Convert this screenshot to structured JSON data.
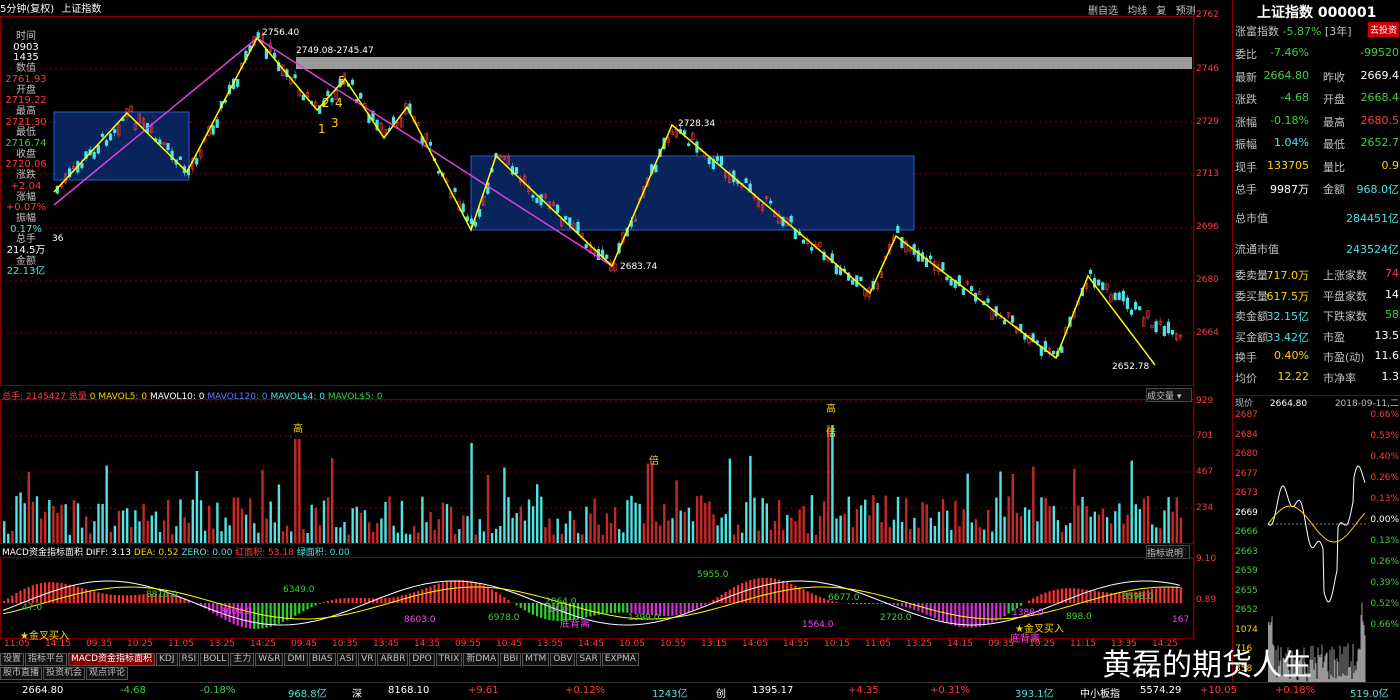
{
  "topbar": {
    "period": "5分钟(复权)",
    "name": "上证指数",
    "buttons": [
      "删自选",
      "均线",
      "复",
      "预测"
    ]
  },
  "left_info": {
    "items": [
      {
        "label": "时间",
        "value": "0903",
        "color": "white"
      },
      {
        "label": "",
        "value": "1435",
        "color": "white"
      },
      {
        "label": "数值",
        "value": "2761.93",
        "color": "red"
      },
      {
        "label": "开盘",
        "value": "2719.22",
        "color": "red"
      },
      {
        "label": "最高",
        "value": "2721.30",
        "color": "red"
      },
      {
        "label": "最低",
        "value": "2716.74",
        "color": "green"
      },
      {
        "label": "收盘",
        "value": "2720.06",
        "color": "red"
      },
      {
        "label": "涨跌",
        "value": "+2.04",
        "color": "red"
      },
      {
        "label": "涨幅",
        "value": "+0.07%",
        "color": "red"
      },
      {
        "label": "振幅",
        "value": "0.17%",
        "color": "cyan"
      },
      {
        "label": "总手",
        "value": "214.5万",
        "color": "white"
      },
      {
        "label": "金额",
        "value": "22.13亿",
        "color": "cyan"
      }
    ]
  },
  "price_axis": [
    "2762",
    "2746",
    "2729",
    "2713",
    "2696",
    "2680",
    "2664"
  ],
  "price_annotations": {
    "high1": "2756.40",
    "range": "2749.08-2745.47",
    "mid_high": "2728.34",
    "low1": "2683.74",
    "low2": "2652.78",
    "left36": "36",
    "nums": [
      "1",
      "2",
      "3",
      "4",
      "5"
    ]
  },
  "volume": {
    "header": [
      {
        "text": "总手: 2145427",
        "color": "red"
      },
      {
        "text": "总量",
        "color": "red"
      },
      {
        "text": "0 MAVOL5: 0",
        "color": "yellow"
      },
      {
        "text": "MAVOL10: 0",
        "color": "white"
      },
      {
        "text": "MAVOL120: 0",
        "color": "blue"
      },
      {
        "text": "MAVOL$4: 0",
        "color": "cyan"
      },
      {
        "text": "MAVOL$5: 0",
        "color": "green"
      }
    ],
    "axis": [
      "929",
      "701",
      "467",
      "234"
    ],
    "button": "成交量",
    "marks": {
      "high": "高",
      "bei": "倍"
    }
  },
  "macd": {
    "header": [
      {
        "text": "MACD资金指标面积",
        "color": "white"
      },
      {
        "text": "DIFF: 3.13",
        "color": "white"
      },
      {
        "text": "DEA: 0.52",
        "color": "yellow"
      },
      {
        "text": "ZERO: 0.00",
        "color": "cyan"
      },
      {
        "text": "红面积: 53.18",
        "color": "red"
      },
      {
        "text": "绿面积: 0.00",
        "color": "cyan"
      }
    ],
    "axis": [
      "9.10",
      "0.89"
    ],
    "button": "指标说明",
    "labels": [
      "47.0",
      "3604.0",
      "8819.0",
      "6349.0",
      "8603.0",
      "6978.0",
      "2064.0",
      "14.0",
      "1399.0",
      "5955.0",
      "1564.0",
      "6677.0",
      "2720.0",
      "1388.0",
      "898.0",
      "3598.0",
      "167"
    ],
    "signals": [
      "金叉买入",
      "底背离",
      "金叉买入",
      "底背离"
    ]
  },
  "time_axis": [
    "11:05",
    "14:15",
    "09:35",
    "10:25",
    "11:05",
    "13:25",
    "14:25",
    "09:45",
    "10:35",
    "13:45",
    "14:35",
    "09:55",
    "10:45",
    "13:55",
    "14:45",
    "10:05",
    "10:55",
    "13:15",
    "14:05",
    "14:55",
    "10:15",
    "11:05",
    "13:25",
    "14:15",
    "09:35",
    "10:25",
    "11:15",
    "13:35",
    "14:25"
  ],
  "tabs": [
    "设置",
    "指标平台",
    "MACD资金指标面积",
    "KDJ",
    "RSI",
    "BOLL",
    "主力",
    "W&R",
    "DMI",
    "BIAS",
    "ASI",
    "VR",
    "ARBR",
    "DPO",
    "TRIX",
    "新DMA",
    "BBI",
    "MTM",
    "OBV",
    "SAR",
    "EXPMA"
  ],
  "tabs2": [
    "股市直播",
    "投资机会",
    "观点评论"
  ],
  "bottom": [
    {
      "text": "2664.80",
      "color": "white"
    },
    {
      "text": "-4.68",
      "color": "green"
    },
    {
      "text": "-0.18%",
      "color": "green"
    },
    {
      "text": "968.8亿",
      "color": "cyan"
    },
    {
      "text": "深",
      "color": "white"
    },
    {
      "text": "8168.10",
      "color": "white"
    },
    {
      "text": "+9.61",
      "color": "red"
    },
    {
      "text": "+0.12%",
      "color": "red"
    },
    {
      "text": "1243亿",
      "color": "cyan"
    },
    {
      "text": "创",
      "color": "white"
    },
    {
      "text": "1395.17",
      "color": "white"
    },
    {
      "text": "+4.35",
      "color": "red"
    },
    {
      "text": "+0.31%",
      "color": "red"
    },
    {
      "text": "393.1亿",
      "color": "cyan"
    },
    {
      "text": "中小板指",
      "color": "white"
    },
    {
      "text": "5574.29",
      "color": "white"
    },
    {
      "text": "+10.05",
      "color": "red"
    },
    {
      "text": "+0.18%",
      "color": "red"
    },
    {
      "text": "519.0亿",
      "color": "cyan"
    }
  ],
  "right_panel": {
    "title": "上证指数 000001",
    "sub_name": "涨富指数",
    "sub_change": "-5.87%",
    "sub_period": "[3年]",
    "sub_btn": "去投资",
    "rows": [
      {
        "k": "委比",
        "v": "-7.46%",
        "vc": "green",
        "k2": "",
        "v2": "-99520",
        "v2c": "green"
      },
      {
        "k": "最新",
        "v": "2664.80",
        "vc": "green",
        "k2": "昨收",
        "v2": "2669.4",
        "v2c": "white"
      },
      {
        "k": "涨跌",
        "v": "-4.68",
        "vc": "green",
        "k2": "开盘",
        "v2": "2668.4",
        "v2c": "green"
      },
      {
        "k": "涨幅",
        "v": "-0.18%",
        "vc": "green",
        "k2": "最高",
        "v2": "2680.5",
        "v2c": "red"
      },
      {
        "k": "振幅",
        "v": "1.04%",
        "vc": "cyan",
        "k2": "最低",
        "v2": "2652.7",
        "v2c": "green"
      },
      {
        "k": "现手",
        "v": "133705",
        "vc": "yellow",
        "k2": "量比",
        "v2": "0.9",
        "v2c": "yellow"
      },
      {
        "k": "总手",
        "v": "9987万",
        "vc": "white",
        "k2": "金额",
        "v2": "968.0亿",
        "v2c": "cyan"
      }
    ],
    "market_cap": [
      {
        "k": "总市值",
        "v": "284451亿"
      },
      {
        "k": "流通市值",
        "v": "243524亿"
      }
    ],
    "rows2": [
      {
        "k": "委卖量",
        "v": "717.0万",
        "vc": "yellow",
        "k2": "上涨家数",
        "v2": "74",
        "v2c": "red"
      },
      {
        "k": "委买量",
        "v": "617.5万",
        "vc": "yellow",
        "k2": "平盘家数",
        "v2": "14",
        "v2c": "white"
      },
      {
        "k": "卖金额",
        "v": "32.15亿",
        "vc": "cyan",
        "k2": "下跌家数",
        "v2": "58",
        "v2c": "green"
      },
      {
        "k": "买金额",
        "v": "33.42亿",
        "vc": "cyan",
        "k2": "市盈",
        "v2": "13.5",
        "v2c": "white"
      },
      {
        "k": "换手",
        "v": "0.40%",
        "vc": "yellow",
        "k2": "市盈(动)",
        "v2": "11.6",
        "v2c": "white"
      },
      {
        "k": "均价",
        "v": "12.22",
        "vc": "yellow",
        "k2": "市净率",
        "v2": "1.3",
        "v2c": "white"
      }
    ],
    "mini_header": {
      "label": "现价",
      "price": "2664.80",
      "date": "2018-09-11,二"
    },
    "mini_left": [
      "2687",
      "2684",
      "2680",
      "2677",
      "2673",
      "2669",
      "2666",
      "2663",
      "2659",
      "2655",
      "2652",
      "1074",
      "716",
      "358"
    ],
    "mini_right": [
      "0.66%",
      "0.53%",
      "0.40%",
      "0.26%",
      "0.13%",
      "0.00%",
      "0.13%",
      "0.26%",
      "0.39%",
      "0.52%",
      "0.66%"
    ]
  },
  "watermark": "黄磊的期货人生"
}
